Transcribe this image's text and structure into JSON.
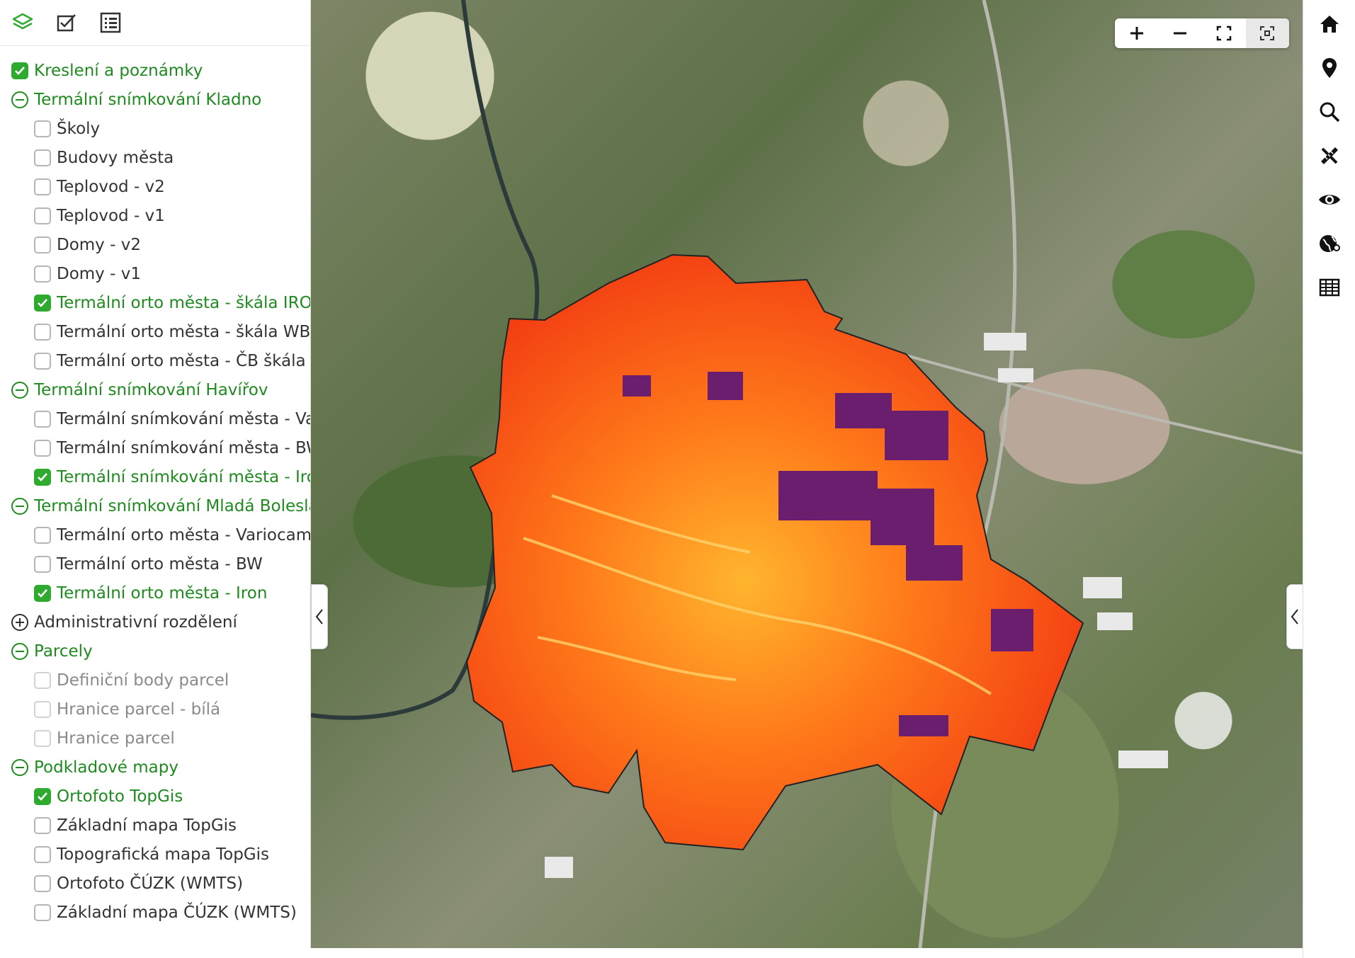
{
  "sidebar": {
    "tools": [
      {
        "name": "layers-icon",
        "active": true
      },
      {
        "name": "checklist-icon",
        "active": false
      },
      {
        "name": "legend-list-icon",
        "active": false
      }
    ],
    "layers": [
      {
        "label": "Kreslení a poznámky",
        "kind": "group-check",
        "checked": true
      },
      {
        "label": "Termální snímkování Kladno",
        "kind": "group",
        "expanded": true
      },
      {
        "label": "Školy",
        "kind": "leaf",
        "checked": false
      },
      {
        "label": "Budovy města",
        "kind": "leaf",
        "checked": false
      },
      {
        "label": "Teplovod - v2",
        "kind": "leaf",
        "checked": false
      },
      {
        "label": "Teplovod - v1",
        "kind": "leaf",
        "checked": false
      },
      {
        "label": "Domy - v2",
        "kind": "leaf",
        "checked": false
      },
      {
        "label": "Domy - v1",
        "kind": "leaf",
        "checked": false
      },
      {
        "label": "Termální orto města - škála IRON",
        "kind": "leaf",
        "checked": true
      },
      {
        "label": "Termální orto města - škála WB",
        "kind": "leaf",
        "checked": false
      },
      {
        "label": "Termální orto města - ČB škála",
        "kind": "leaf",
        "checked": false
      },
      {
        "label": "Termální snímkování Havířov",
        "kind": "group",
        "expanded": true
      },
      {
        "label": "Termální snímkování města - Vari",
        "kind": "leaf",
        "checked": false
      },
      {
        "label": "Termální snímkování města - BW",
        "kind": "leaf",
        "checked": false
      },
      {
        "label": "Termální snímkování města - Iron",
        "kind": "leaf",
        "checked": true
      },
      {
        "label": "Termální snímkování Mladá Boleslav",
        "kind": "group",
        "expanded": true
      },
      {
        "label": "Termální orto města - Variocam",
        "kind": "leaf",
        "checked": false
      },
      {
        "label": "Termální orto města - BW",
        "kind": "leaf",
        "checked": false
      },
      {
        "label": "Termální orto města - Iron",
        "kind": "leaf",
        "checked": true
      },
      {
        "label": "Administrativní rozdělení",
        "kind": "group",
        "expanded": false
      },
      {
        "label": "Parcely",
        "kind": "group",
        "expanded": true
      },
      {
        "label": "Definiční body parcel",
        "kind": "leaf",
        "checked": false,
        "disabled": true
      },
      {
        "label": "Hranice parcel - bílá",
        "kind": "leaf",
        "checked": false,
        "disabled": true
      },
      {
        "label": "Hranice parcel",
        "kind": "leaf",
        "checked": false,
        "disabled": true
      },
      {
        "label": "Podkladové mapy",
        "kind": "group",
        "expanded": true
      },
      {
        "label": "Ortofoto TopGis",
        "kind": "leaf",
        "checked": true
      },
      {
        "label": "Základní mapa TopGis",
        "kind": "leaf",
        "checked": false
      },
      {
        "label": "Topografická mapa TopGis",
        "kind": "leaf",
        "checked": false
      },
      {
        "label": "Ortofoto ČÚZK (WMTS)",
        "kind": "leaf",
        "checked": false
      },
      {
        "label": "Základní mapa ČÚZK (WMTS)",
        "kind": "leaf",
        "checked": false
      }
    ]
  },
  "map": {
    "zoom_controls": [
      {
        "name": "zoom-in-button",
        "icon": "plus-icon"
      },
      {
        "name": "zoom-out-button",
        "icon": "minus-icon"
      },
      {
        "name": "fullscreen-button",
        "icon": "fullscreen-icon"
      },
      {
        "name": "zoom-to-extent-button",
        "icon": "fit-extent-icon"
      }
    ],
    "overlay_palette": [
      "#f23a12",
      "#ff7a1a",
      "#ffb52e",
      "#6b1d6e"
    ]
  },
  "right_toolbar": [
    {
      "name": "home-button",
      "icon": "home-icon"
    },
    {
      "name": "location-button",
      "icon": "map-pin-icon"
    },
    {
      "name": "search-button",
      "icon": "search-icon"
    },
    {
      "name": "measure-button",
      "icon": "ruler-pencil-icon"
    },
    {
      "name": "visibility-button",
      "icon": "eye-icon"
    },
    {
      "name": "web-map-button",
      "icon": "globe-icon"
    },
    {
      "name": "attribute-table-button",
      "icon": "table-icon"
    }
  ],
  "colors": {
    "accent_green": "#1f8a1f",
    "checkbox_green": "#2eab2e"
  }
}
